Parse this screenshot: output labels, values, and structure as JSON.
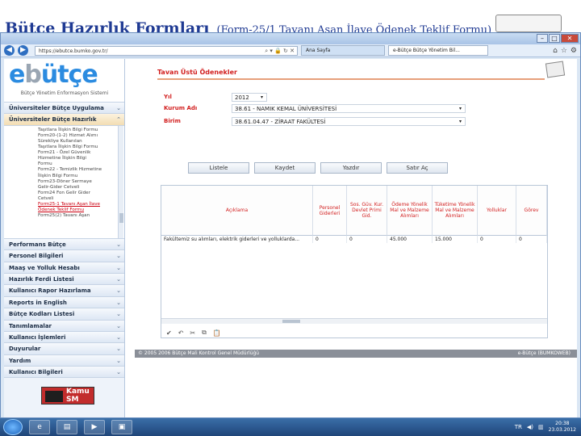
{
  "slide": {
    "title": "Bütçe Hazırlık Formları",
    "subtitle": "(Form-25/1 Tavanı Aşan İlave Ödenek Teklif Formu)"
  },
  "browser": {
    "address": "https://ebutce.bumko.gov.tr/",
    "tab1": "Ana Sayfa",
    "tab2": "e-Bütçe Bütçe Yönetim Bil..."
  },
  "sidebar": {
    "logo_text": "ebütçe",
    "logo_caption": "Bütçe Yönetim Enformasyon Sistemi",
    "items": [
      {
        "label": "Üniversiteler Bütçe Uygulama"
      },
      {
        "label": "Üniversiteler Bütçe Hazırlık"
      },
      {
        "label": "Performans Bütçe"
      },
      {
        "label": "Personel Bilgileri"
      },
      {
        "label": "Maaş ve Yolluk Hesabı"
      },
      {
        "label": "Hazırlık Ferdi Listesi"
      },
      {
        "label": "Kullanıcı Rapor Hazırlama"
      },
      {
        "label": "Reports in English"
      },
      {
        "label": "Bütçe Kodları Listesi"
      },
      {
        "label": "Tanımlamalar"
      },
      {
        "label": "Kullanıcı İşlemleri"
      },
      {
        "label": "Duyurular"
      },
      {
        "label": "Yardım"
      },
      {
        "label": "Kullanıcı Bilgileri"
      }
    ],
    "submenu": [
      "Taşıtlara İlişkin Bilgi Formu",
      "Form20-(1-2) Hizmet Alımı",
      "Sürekliye Kullanılan",
      "Taşıtlara İlişkin Bilgi Formu",
      "Form21 - Özel Güvenlik",
      "Hizmetine İlişkin Bilgi",
      "Formu",
      "Form22 - Temizlik Hizmetine",
      "İlişkin Bilgi Formu",
      "Form23-Döner Sermaye",
      "Gelir-Gider Cetveli",
      "Form24 Fon Gelir Gider",
      "Cetveli",
      "Form25-1 Tavanı Aşan İlave",
      "Ödenek Teklif Formu",
      "Form25(2) Tavanı Aşan"
    ],
    "kamu": "Kamu SM"
  },
  "content": {
    "header": "Tavan Üstü Ödenekler",
    "yil_label": "Yıl",
    "yil_value": "2012",
    "kurum_label": "Kurum Adı",
    "kurum_value": "38.61 - NAMIK KEMAL ÜNİVERSİTESİ",
    "birim_label": "Birim",
    "birim_value": "38.61.04.47 - ZİRAAT FAKÜLTESİ",
    "buttons": {
      "listele": "Listele",
      "kaydet": "Kaydet",
      "yazdir": "Yazdır",
      "satir_ac": "Satır Aç"
    },
    "grid_headers": [
      "Açıklama",
      "Personel Giderleri",
      "Sos. Güv. Kur. Devlet Primi Gid.",
      "Ödeme Yönelik Mal ve Malzeme Alımları",
      "Tüketime Yönelik Mal ve Malzeme Alımları",
      "Yolluklar",
      "Görev"
    ],
    "grid_row": [
      "Fakültemiz su alımları, elektrik giderleri ve yolluklarda...",
      "0",
      "0",
      "45.000",
      "15.000",
      "0",
      "0"
    ],
    "toolbar_icons": [
      "check-icon",
      "undo-icon",
      "cut-icon",
      "copy-icon",
      "paste-icon"
    ]
  },
  "footer": {
    "left": "© 2005 2006 Bütçe Mali Kontrol Genel Müdürlüğü",
    "right": "e-Bütçe (BUMKOWEB)"
  },
  "taskbar": {
    "time": "20:38",
    "date": "23.03.2012",
    "lang": "TR"
  },
  "colors": {
    "accent_red": "#d21f1f",
    "title_blue": "#1f3a93",
    "taskbar": "#1f4579"
  }
}
